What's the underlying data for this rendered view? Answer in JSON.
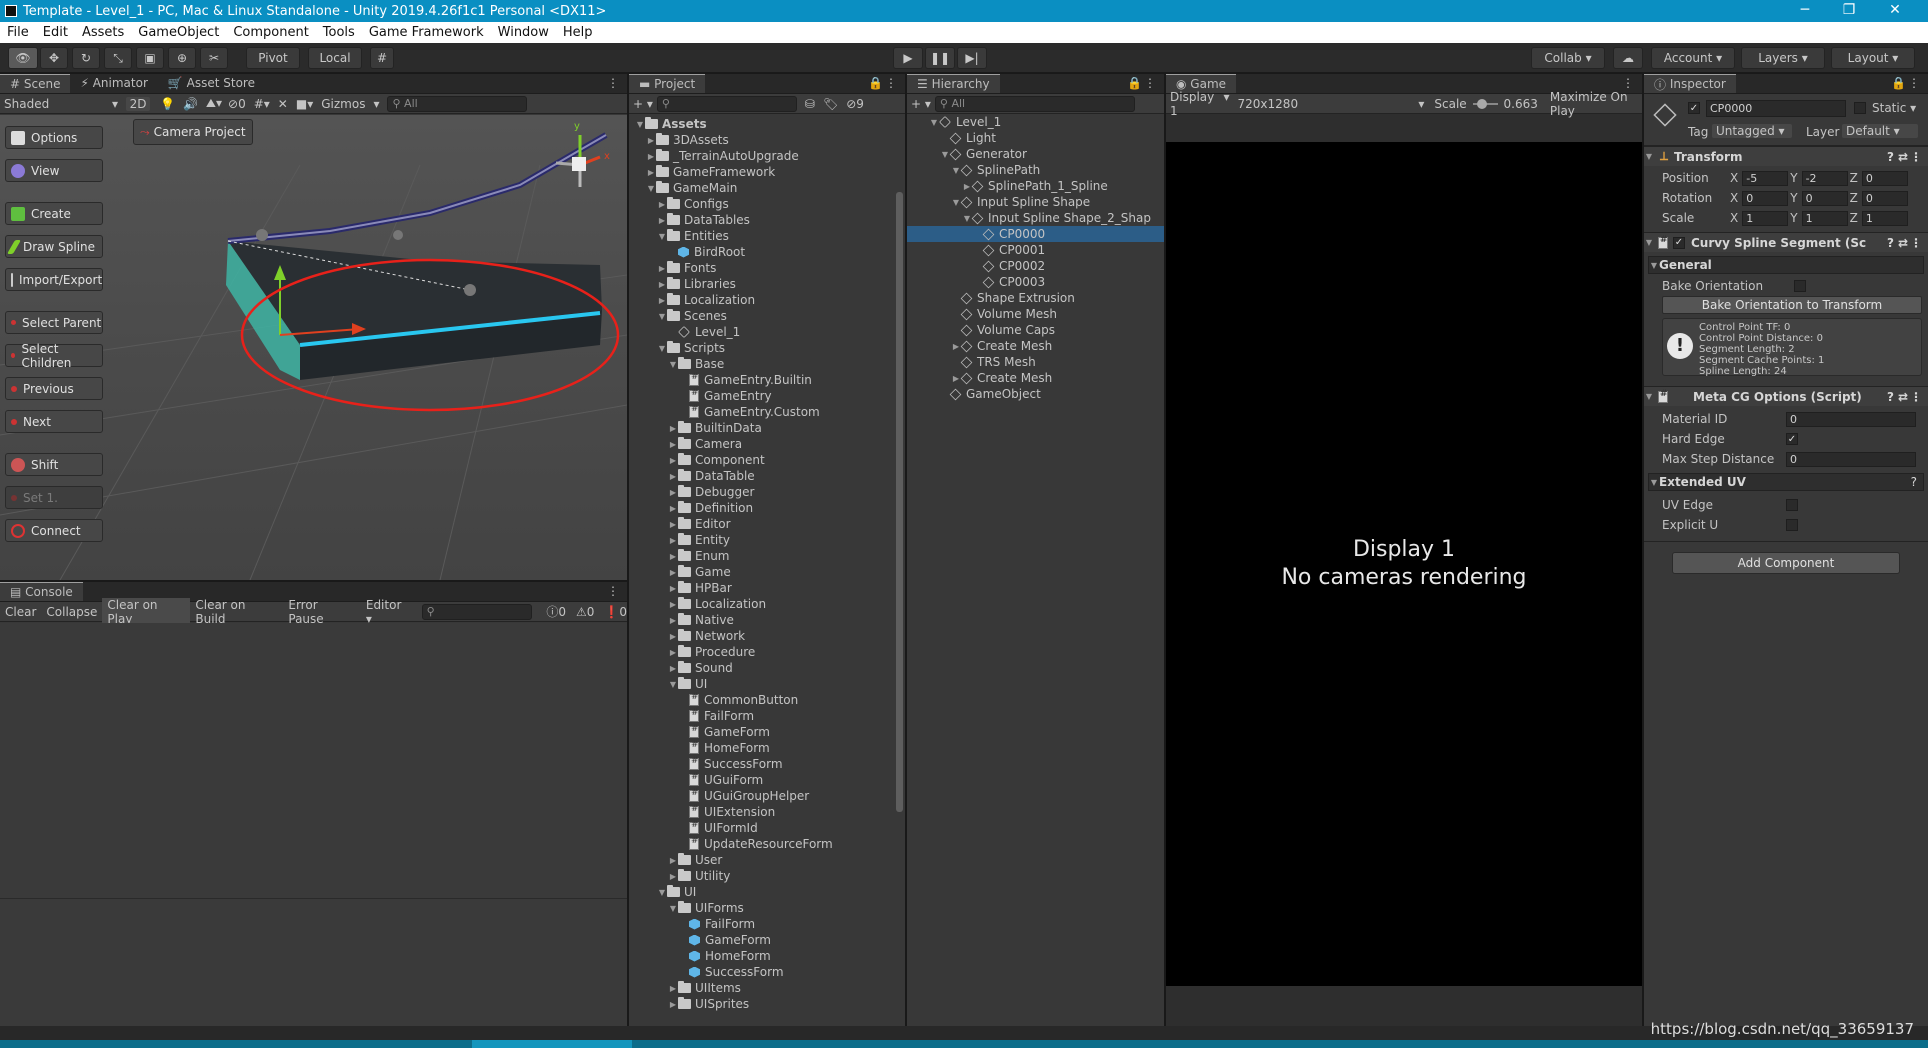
{
  "window": {
    "title": "Template - Level_1 - PC, Mac & Linux Standalone - Unity 2019.4.26f1c1 Personal <DX11>",
    "minimize": "─",
    "maximize": "❐",
    "close": "✕"
  },
  "menu": [
    "File",
    "Edit",
    "Assets",
    "GameObject",
    "Component",
    "Tools",
    "Game Framework",
    "Window",
    "Help"
  ],
  "toolbar": {
    "pivot": "Pivot",
    "local": "Local",
    "collab": "Collab",
    "account": "Account",
    "layers": "Layers",
    "layout": "Layout"
  },
  "scene": {
    "tabs": [
      "Scene",
      "Animator",
      "Asset Store"
    ],
    "shading": "Shaded",
    "mode2d": "2D",
    "hidden_count": "0",
    "gizmos": "Gizmos",
    "search_placeholder": "All",
    "camera_project": "Camera Project",
    "buttons": [
      "Options",
      "View",
      "Create",
      "Draw Spline",
      "Import/Export",
      "Select Parent",
      "Select Children",
      "Previous",
      "Next",
      "Shift",
      "Set 1.",
      "Connect"
    ]
  },
  "console": {
    "tab": "Console",
    "buttons": [
      "Clear",
      "Collapse",
      "Clear on Play",
      "Clear on Build",
      "Error Pause",
      "Editor"
    ],
    "counts": [
      "0",
      "0",
      "0"
    ]
  },
  "project": {
    "tab": "Project",
    "hidden_count": "9",
    "items": [
      {
        "label": "Assets",
        "depth": 0,
        "kind": "folder",
        "arrow": "▼",
        "bold": true
      },
      {
        "label": "3DAssets",
        "depth": 1,
        "kind": "folder",
        "arrow": "▶"
      },
      {
        "label": "_TerrainAutoUpgrade",
        "depth": 1,
        "kind": "folder",
        "arrow": "▶"
      },
      {
        "label": "GameFramework",
        "depth": 1,
        "kind": "folder",
        "arrow": "▶"
      },
      {
        "label": "GameMain",
        "depth": 1,
        "kind": "folder",
        "arrow": "▼"
      },
      {
        "label": "Configs",
        "depth": 2,
        "kind": "folder",
        "arrow": "▶"
      },
      {
        "label": "DataTables",
        "depth": 2,
        "kind": "folder",
        "arrow": "▶"
      },
      {
        "label": "Entities",
        "depth": 2,
        "kind": "folder",
        "arrow": "▼"
      },
      {
        "label": "BirdRoot",
        "depth": 3,
        "kind": "prefab",
        "arrow": ""
      },
      {
        "label": "Fonts",
        "depth": 2,
        "kind": "folder",
        "arrow": "▶"
      },
      {
        "label": "Libraries",
        "depth": 2,
        "kind": "folder",
        "arrow": "▶"
      },
      {
        "label": "Localization",
        "depth": 2,
        "kind": "folder",
        "arrow": "▶"
      },
      {
        "label": "Scenes",
        "depth": 2,
        "kind": "folder",
        "arrow": "▼"
      },
      {
        "label": "Level_1",
        "depth": 3,
        "kind": "scene",
        "arrow": ""
      },
      {
        "label": "Scripts",
        "depth": 2,
        "kind": "folder",
        "arrow": "▼"
      },
      {
        "label": "Base",
        "depth": 3,
        "kind": "folder",
        "arrow": "▼"
      },
      {
        "label": "GameEntry.Builtin",
        "depth": 4,
        "kind": "script",
        "arrow": ""
      },
      {
        "label": "GameEntry",
        "depth": 4,
        "kind": "script",
        "arrow": ""
      },
      {
        "label": "GameEntry.Custom",
        "depth": 4,
        "kind": "script",
        "arrow": ""
      },
      {
        "label": "BuiltinData",
        "depth": 3,
        "kind": "folder",
        "arrow": "▶"
      },
      {
        "label": "Camera",
        "depth": 3,
        "kind": "folder",
        "arrow": "▶"
      },
      {
        "label": "Component",
        "depth": 3,
        "kind": "folder",
        "arrow": "▶"
      },
      {
        "label": "DataTable",
        "depth": 3,
        "kind": "folder",
        "arrow": "▶"
      },
      {
        "label": "Debugger",
        "depth": 3,
        "kind": "folder",
        "arrow": "▶"
      },
      {
        "label": "Definition",
        "depth": 3,
        "kind": "folder",
        "arrow": "▶"
      },
      {
        "label": "Editor",
        "depth": 3,
        "kind": "folder",
        "arrow": "▶"
      },
      {
        "label": "Entity",
        "depth": 3,
        "kind": "folder",
        "arrow": "▶"
      },
      {
        "label": "Enum",
        "depth": 3,
        "kind": "folder",
        "arrow": "▶"
      },
      {
        "label": "Game",
        "depth": 3,
        "kind": "folder",
        "arrow": "▶"
      },
      {
        "label": "HPBar",
        "depth": 3,
        "kind": "folder",
        "arrow": "▶"
      },
      {
        "label": "Localization",
        "depth": 3,
        "kind": "folder",
        "arrow": "▶"
      },
      {
        "label": "Native",
        "depth": 3,
        "kind": "folder",
        "arrow": "▶"
      },
      {
        "label": "Network",
        "depth": 3,
        "kind": "folder",
        "arrow": "▶"
      },
      {
        "label": "Procedure",
        "depth": 3,
        "kind": "folder",
        "arrow": "▶"
      },
      {
        "label": "Sound",
        "depth": 3,
        "kind": "folder",
        "arrow": "▶"
      },
      {
        "label": "UI",
        "depth": 3,
        "kind": "folder",
        "arrow": "▼"
      },
      {
        "label": "CommonButton",
        "depth": 4,
        "kind": "script",
        "arrow": ""
      },
      {
        "label": "FailForm",
        "depth": 4,
        "kind": "script",
        "arrow": ""
      },
      {
        "label": "GameForm",
        "depth": 4,
        "kind": "script",
        "arrow": ""
      },
      {
        "label": "HomeForm",
        "depth": 4,
        "kind": "script",
        "arrow": ""
      },
      {
        "label": "SuccessForm",
        "depth": 4,
        "kind": "script",
        "arrow": ""
      },
      {
        "label": "UGuiForm",
        "depth": 4,
        "kind": "script",
        "arrow": ""
      },
      {
        "label": "UGuiGroupHelper",
        "depth": 4,
        "kind": "script",
        "arrow": ""
      },
      {
        "label": "UIExtension",
        "depth": 4,
        "kind": "script",
        "arrow": ""
      },
      {
        "label": "UIFormId",
        "depth": 4,
        "kind": "script",
        "arrow": ""
      },
      {
        "label": "UpdateResourceForm",
        "depth": 4,
        "kind": "script",
        "arrow": ""
      },
      {
        "label": "User",
        "depth": 3,
        "kind": "folder",
        "arrow": "▶"
      },
      {
        "label": "Utility",
        "depth": 3,
        "kind": "folder",
        "arrow": "▶"
      },
      {
        "label": "UI",
        "depth": 2,
        "kind": "folder",
        "arrow": "▼"
      },
      {
        "label": "UIForms",
        "depth": 3,
        "kind": "folder",
        "arrow": "▼"
      },
      {
        "label": "FailForm",
        "depth": 4,
        "kind": "prefab",
        "arrow": ""
      },
      {
        "label": "GameForm",
        "depth": 4,
        "kind": "prefab",
        "arrow": ""
      },
      {
        "label": "HomeForm",
        "depth": 4,
        "kind": "prefab",
        "arrow": ""
      },
      {
        "label": "SuccessForm",
        "depth": 4,
        "kind": "prefab",
        "arrow": ""
      },
      {
        "label": "UIItems",
        "depth": 3,
        "kind": "folder",
        "arrow": "▶"
      },
      {
        "label": "UISprites",
        "depth": 3,
        "kind": "folder",
        "arrow": "▶"
      }
    ]
  },
  "hierarchy": {
    "tab": "Hierarchy",
    "search_placeholder": "All",
    "items": [
      {
        "label": "Level_1",
        "depth": 0,
        "kind": "scene",
        "arrow": "▼"
      },
      {
        "label": "Light",
        "depth": 1,
        "kind": "cube",
        "arrow": ""
      },
      {
        "label": "Generator",
        "depth": 1,
        "kind": "cube",
        "arrow": "▼"
      },
      {
        "label": "SplinePath",
        "depth": 2,
        "kind": "cube",
        "arrow": "▼"
      },
      {
        "label": "SplinePath_1_Spline",
        "depth": 3,
        "kind": "cube",
        "arrow": "▶"
      },
      {
        "label": "Input Spline Shape",
        "depth": 2,
        "kind": "cube",
        "arrow": "▼"
      },
      {
        "label": "Input Spline Shape_2_Shap",
        "depth": 3,
        "kind": "cube",
        "arrow": "▼"
      },
      {
        "label": "CP0000",
        "depth": 4,
        "kind": "cube",
        "arrow": "",
        "selected": true
      },
      {
        "label": "CP0001",
        "depth": 4,
        "kind": "cube",
        "arrow": ""
      },
      {
        "label": "CP0002",
        "depth": 4,
        "kind": "cube",
        "arrow": ""
      },
      {
        "label": "CP0003",
        "depth": 4,
        "kind": "cube",
        "arrow": ""
      },
      {
        "label": "Shape Extrusion",
        "depth": 2,
        "kind": "cube",
        "arrow": ""
      },
      {
        "label": "Volume Mesh",
        "depth": 2,
        "kind": "cube",
        "arrow": ""
      },
      {
        "label": "Volume Caps",
        "depth": 2,
        "kind": "cube",
        "arrow": ""
      },
      {
        "label": "Create Mesh",
        "depth": 2,
        "kind": "cube",
        "arrow": "▶"
      },
      {
        "label": "TRS Mesh",
        "depth": 2,
        "kind": "cube",
        "arrow": ""
      },
      {
        "label": "Create Mesh",
        "depth": 2,
        "kind": "cube",
        "arrow": "▶"
      },
      {
        "label": "GameObject",
        "depth": 1,
        "kind": "cube",
        "arrow": ""
      }
    ]
  },
  "game": {
    "tab": "Game",
    "display": "Display 1",
    "resolution": "720x1280",
    "scale_label": "Scale",
    "scale_value": "0.663",
    "maximize": "Maximize On Play",
    "message_line1": "Display 1",
    "message_line2": "No cameras rendering"
  },
  "inspector": {
    "tab": "Inspector",
    "object_name": "CP0000",
    "static": "Static",
    "tag_label": "Tag",
    "tag_value": "Untagged",
    "layer_label": "Layer",
    "layer_value": "Default",
    "transform": {
      "title": "Transform",
      "rows": [
        {
          "label": "Position",
          "x": "-5",
          "y": "-2",
          "z": "0"
        },
        {
          "label": "Rotation",
          "x": "0",
          "y": "0",
          "z": "0"
        },
        {
          "label": "Scale",
          "x": "1",
          "y": "1",
          "z": "1"
        }
      ]
    },
    "curvy": {
      "title": "Curvy Spline Segment (Sc",
      "general": "General",
      "bake_orientation": "Bake Orientation",
      "bake_button": "Bake Orientation to Transform",
      "info": [
        "Control Point TF: 0",
        "Control Point Distance: 0",
        "Segment Length: 2",
        "Segment Cache Points: 1",
        "Spline Length: 24"
      ]
    },
    "meta": {
      "title": "Meta CG Options (Script)",
      "material_id_label": "Material ID",
      "material_id": "0",
      "hard_edge_label": "Hard Edge",
      "max_step_label": "Max Step Distance",
      "max_step": "0",
      "extended_uv": "Extended UV",
      "uv_edge": "UV Edge",
      "explicit_u": "Explicit U"
    },
    "add_component": "Add Component"
  },
  "watermark": "https://blog.csdn.net/qq_33659137"
}
